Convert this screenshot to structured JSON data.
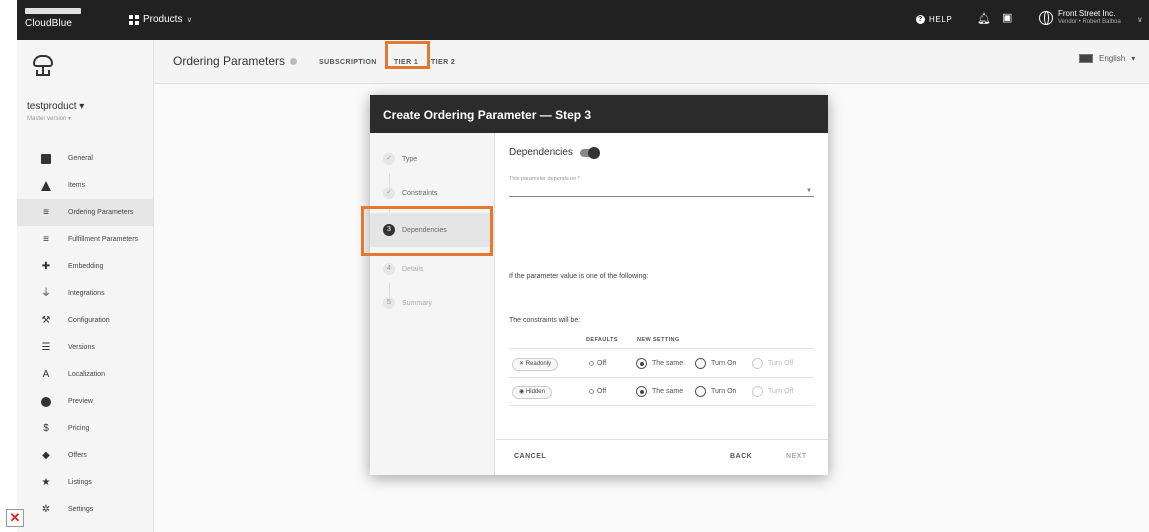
{
  "topbar": {
    "logo_text": "CloudBlue",
    "products_label": "Products",
    "help_label": "HELP",
    "account_name": "Front Street Inc.",
    "account_sub": "Vendor • Robert Balboa"
  },
  "sidebar": {
    "product_name": "testproduct ▾",
    "version_label": "Master version ▾",
    "items": [
      {
        "label": "General",
        "icon": "document-icon"
      },
      {
        "label": "Items",
        "icon": "items-icon"
      },
      {
        "label": "Ordering Parameters",
        "icon": "parameters-icon"
      },
      {
        "label": "Fulfillment Parameters",
        "icon": "fulfillment-icon"
      },
      {
        "label": "Embedding",
        "icon": "puzzle-icon"
      },
      {
        "label": "Integrations",
        "icon": "plug-icon"
      },
      {
        "label": "Configuration",
        "icon": "wrench-icon"
      },
      {
        "label": "Versions",
        "icon": "list-icon"
      },
      {
        "label": "Localization",
        "icon": "translate-icon"
      },
      {
        "label": "Preview",
        "icon": "preview-icon"
      },
      {
        "label": "Pricing",
        "icon": "dollar-icon"
      },
      {
        "label": "Offers",
        "icon": "tag-icon"
      },
      {
        "label": "Listings",
        "icon": "star-icon"
      },
      {
        "label": "Settings",
        "icon": "gear-icon"
      }
    ]
  },
  "header": {
    "title": "Ordering Parameters",
    "tabs": [
      "SUBSCRIPTION",
      "TIER 1",
      "TIER 2"
    ],
    "language": "English"
  },
  "dialog": {
    "title": "Create Ordering Parameter — Step 3",
    "steps": [
      {
        "label": "Type",
        "mark": "✓"
      },
      {
        "label": "Constraints",
        "mark": "✓"
      },
      {
        "label": "Dependencies",
        "mark": "3"
      },
      {
        "label": "Details",
        "mark": "4"
      },
      {
        "label": "Summary",
        "mark": "5"
      }
    ],
    "dependencies_label": "Dependencies",
    "depends_on_label": "This parameter depends on *",
    "if_text": "If the parameter value is one of the following:",
    "constraints_text": "The constraints will be:",
    "col_defaults": "DEFAULTS",
    "col_new": "NEW SETTING",
    "rows": [
      {
        "chip": "✕ Readonly",
        "default": "Off",
        "opt1": "The same",
        "opt2": "Turn On",
        "opt3": "Turn Off"
      },
      {
        "chip": "◉ Hidden",
        "default": "Off",
        "opt1": "The same",
        "opt2": "Turn On",
        "opt3": "Turn Off"
      }
    ],
    "cancel": "CANCEL",
    "back": "BACK",
    "next": "NEXT"
  },
  "colors": {
    "highlight": "#e6772e",
    "topbar": "#212121",
    "dialog_header": "#2b2b2b"
  }
}
